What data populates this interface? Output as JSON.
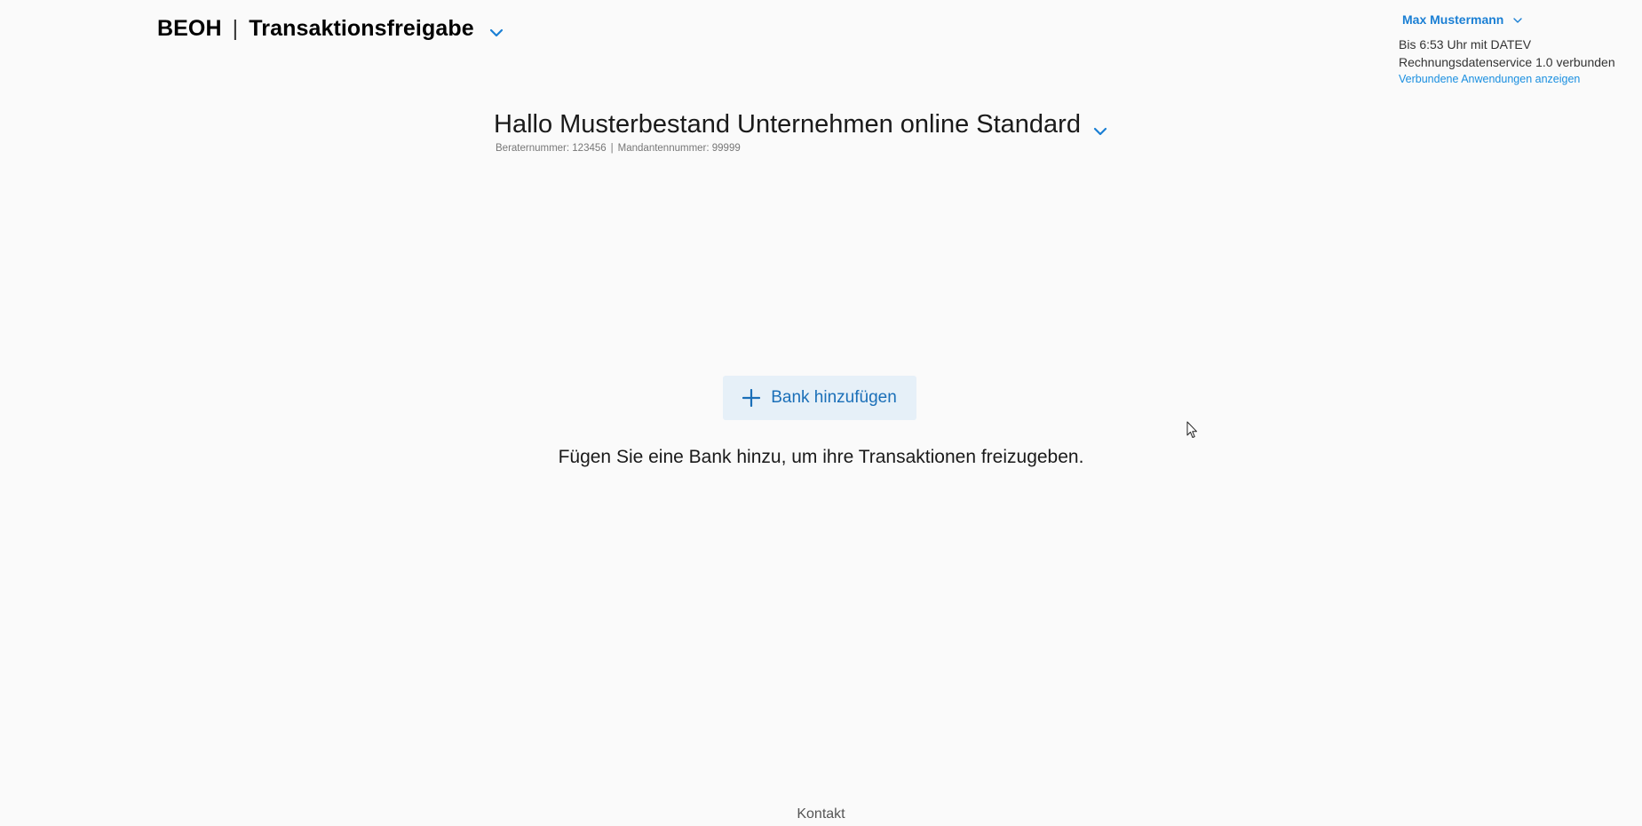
{
  "header": {
    "app_name": "BEOH",
    "separator": "|",
    "module_name": "Transaktionsfreigabe",
    "menu_icon": "chevron-down-icon"
  },
  "user": {
    "name": "Max Mustermann",
    "connection_text": "Bis 6:53 Uhr mit DATEV Rechnungsdatenservice 1.0 verbunden",
    "connected_apps_link": "Verbundene Anwendungen anzeigen"
  },
  "client": {
    "greeting": "Hallo Musterbestand Unternehmen online Standard",
    "advisor_number": "Beraternummer: 123456",
    "separator": "|",
    "client_number": "Mandantennummer: 99999"
  },
  "main": {
    "add_bank_label": "Bank hinzufügen",
    "add_bank_icon": "plus-icon",
    "hint": "Fügen Sie eine Bank hinzu, um ihre Transaktionen freizugeben."
  },
  "footer": {
    "contact_label": "Kontakt"
  },
  "colors": {
    "accent": "#1a7fd4",
    "button_bg": "#e6f0f8",
    "background": "#fafafa"
  }
}
